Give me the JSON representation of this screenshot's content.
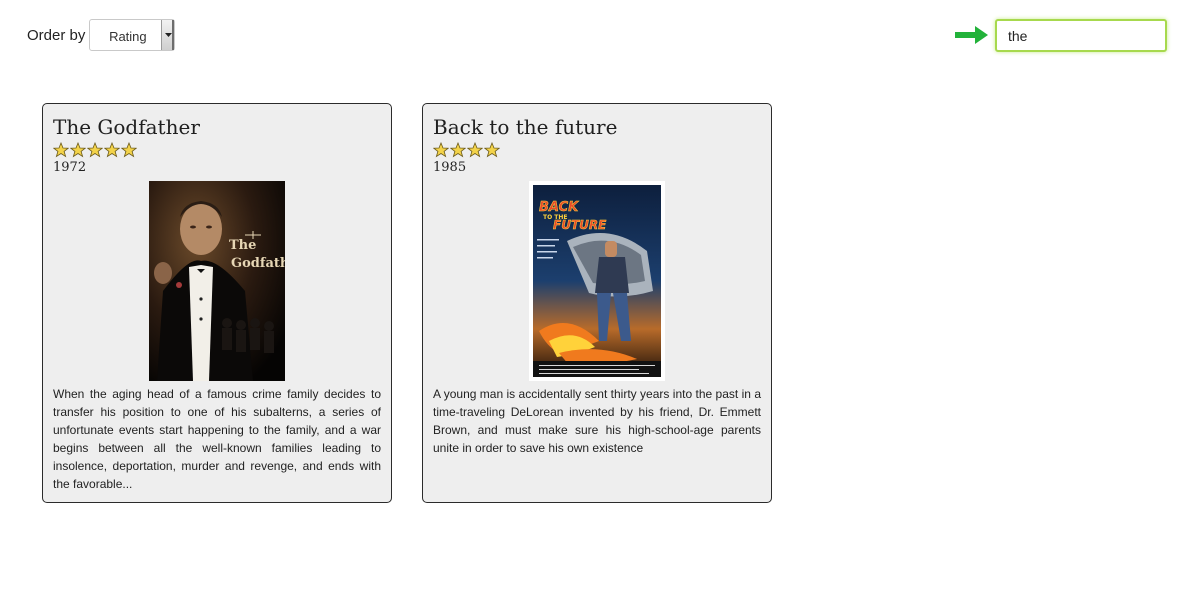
{
  "toolbar": {
    "order_label": "Order by",
    "order_select": {
      "selected": "Rating"
    }
  },
  "search": {
    "value": "the",
    "arrow_icon": "green-right-arrow-icon",
    "accent_color": "#a7d94d",
    "arrow_color": "#22b23a"
  },
  "movies": [
    {
      "title": "The Godfather",
      "rating": 5,
      "year": "1972",
      "poster_text": "The Godfather",
      "description": "When the aging head of a famous crime family decides to transfer his position to one of his subalterns, a series of unfortunate events start happening to the family, and a war begins between all the well-known families leading to insolence, deportation, murder and revenge, and ends with the favorable..."
    },
    {
      "title": "Back to the future",
      "rating": 4,
      "year": "1985",
      "poster_text": "BACK TO THE FUTURE",
      "description": "A young man is accidentally sent thirty years into the past in a time-traveling DeLorean invented by his friend, Dr. Emmett Brown, and must make sure his high-school-age parents unite in order to save his own existence"
    }
  ],
  "colors": {
    "card_background": "#eeeeee",
    "card_border": "#2b2b2b",
    "star_fill": "#f3d34a"
  }
}
